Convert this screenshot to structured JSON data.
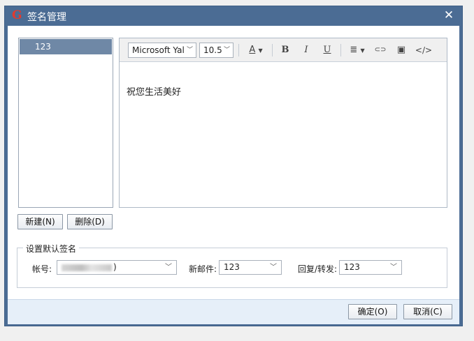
{
  "window": {
    "title": "签名管理",
    "close_glyph": "✕",
    "logo_glyph": "G"
  },
  "signatures": {
    "items": [
      {
        "label": "123",
        "selected": true
      }
    ]
  },
  "toolbar": {
    "font_family": "Microsoft Yal",
    "font_size": "10.5",
    "font_color_glyph": "A",
    "bold_glyph": "B",
    "italic_glyph": "I",
    "underline_glyph": "U",
    "align_glyph": "≣",
    "link_glyph": "⊂⊃",
    "image_glyph": "▣",
    "source_glyph": "</>"
  },
  "editor": {
    "content": "祝您生活美好"
  },
  "buttons": {
    "new_label": "新建(N)",
    "delete_label": "删除(D)",
    "ok_label": "确定(O)",
    "cancel_label": "取消(C)"
  },
  "defaults": {
    "group_title": "设置默认签名",
    "account_label": "帐号:",
    "account_value": ")",
    "new_mail_label": "新邮件:",
    "new_mail_value": "123",
    "reply_label": "回复/转发:",
    "reply_value": "123"
  },
  "colors": {
    "titlebar": "#4b6c94",
    "selected_item": "#6f88a6",
    "logo": "#e23a2e",
    "footer": "#e6eff9"
  }
}
